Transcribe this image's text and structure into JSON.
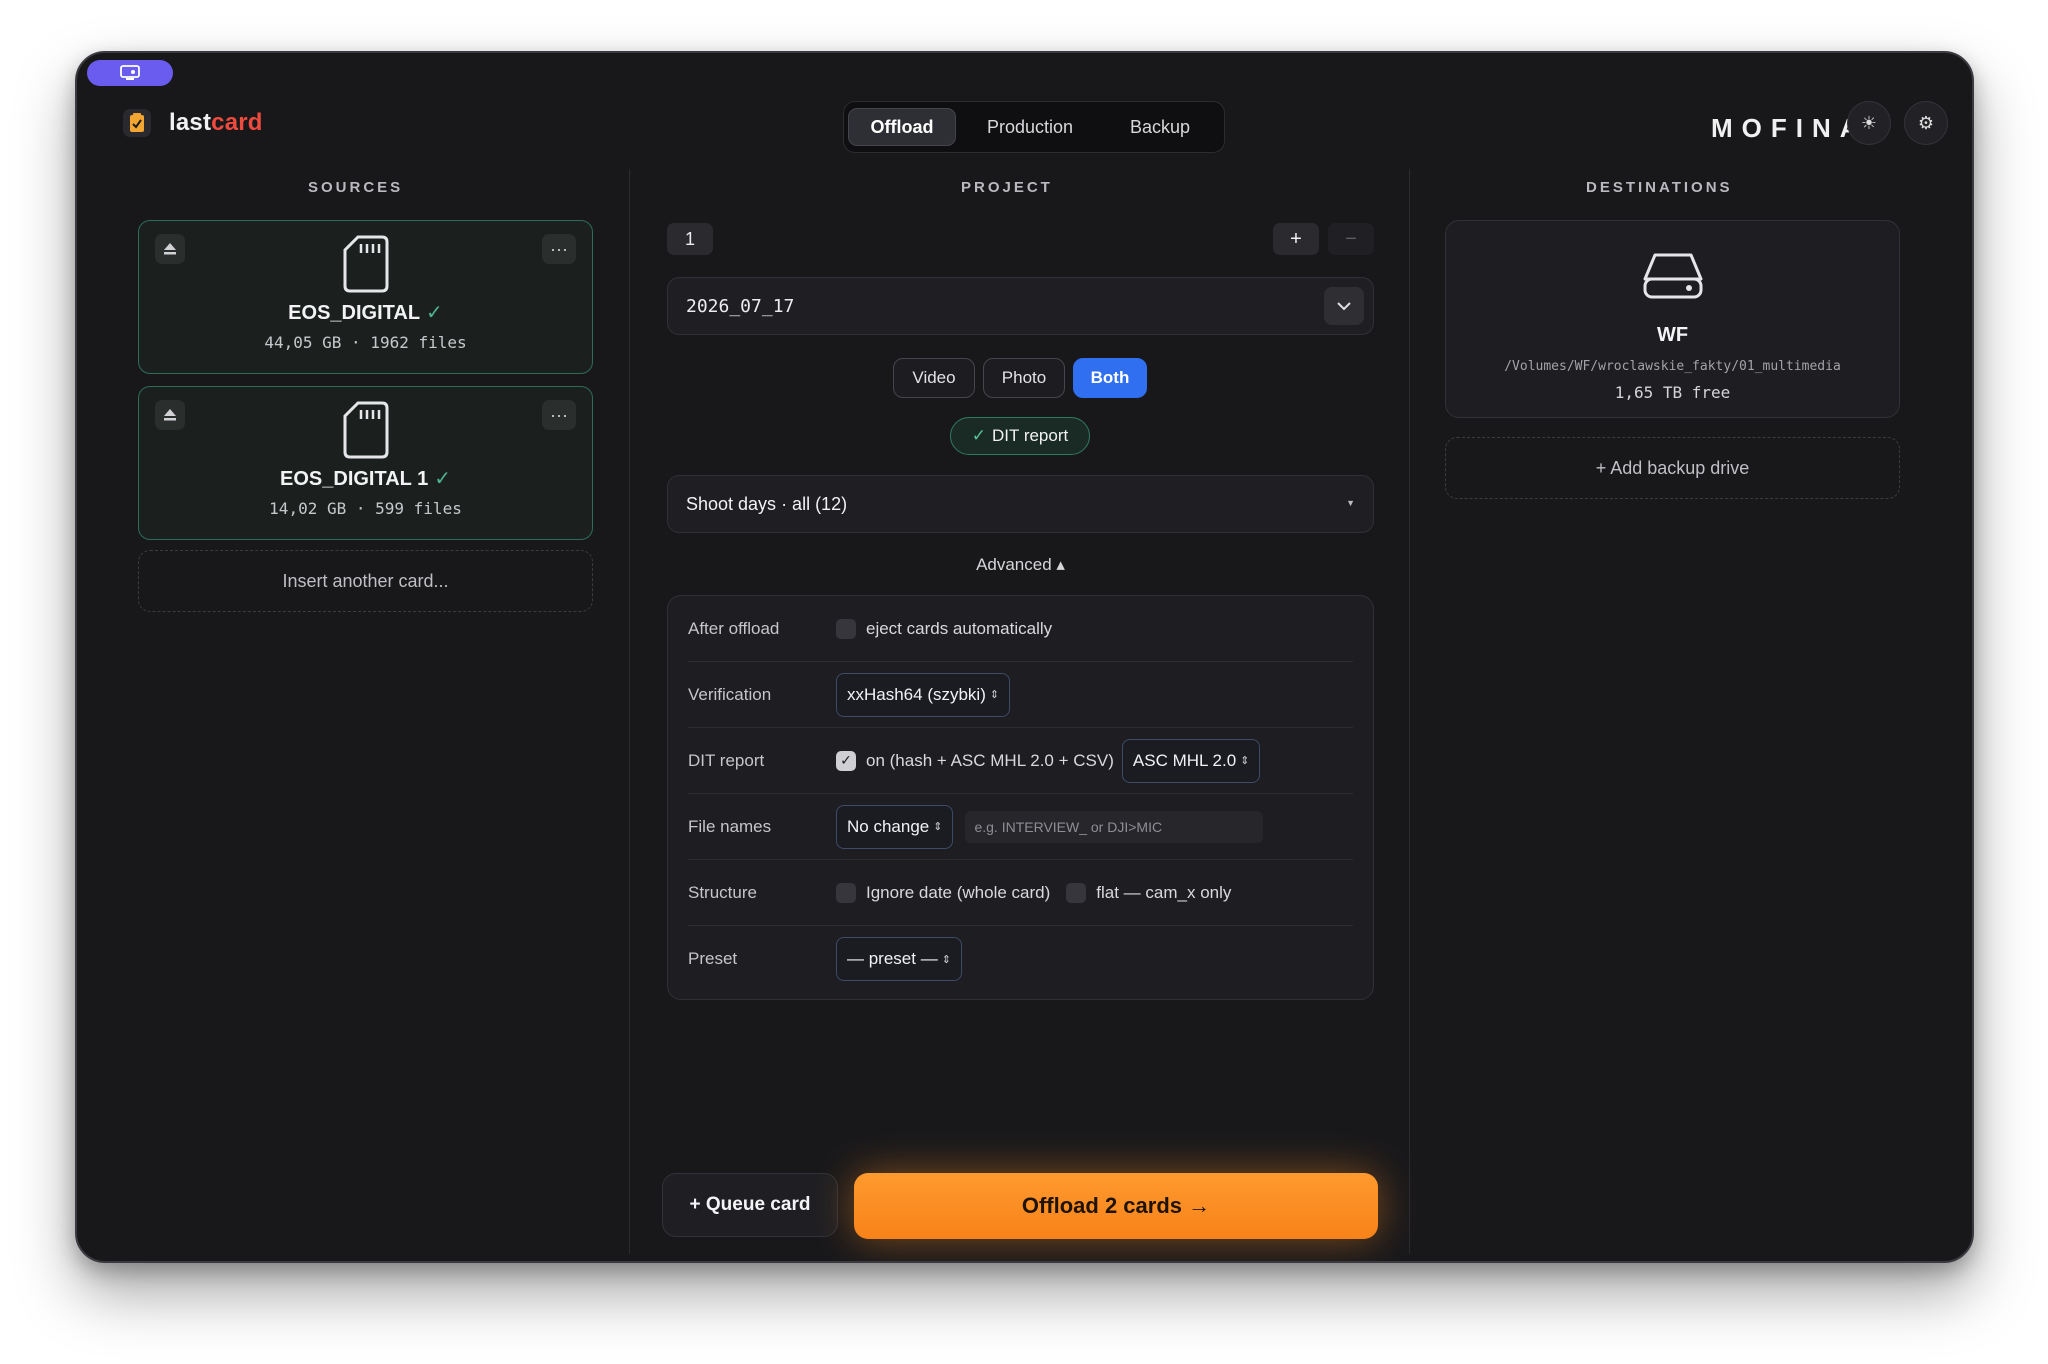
{
  "app": {
    "name_part1": "last",
    "name_part2": "card",
    "vendor": "MOFINA"
  },
  "modes": [
    {
      "label": "Offload",
      "active": true
    },
    {
      "label": "Production",
      "active": false
    },
    {
      "label": "Backup",
      "active": false
    }
  ],
  "sources": {
    "title": "SOURCES",
    "cards": [
      {
        "name": "EOS_DIGITAL",
        "meta": "44,05 GB · 1962 files"
      },
      {
        "name": "EOS_DIGITAL 1",
        "meta": "14,02 GB · 599 files"
      }
    ],
    "insert_label": "Insert another card..."
  },
  "project": {
    "title": "PROJECT",
    "number": "1",
    "add_label": "+",
    "remove_label": "−",
    "folder_name": "2026_07_17",
    "media_types": [
      "Video",
      "Photo",
      "Both"
    ],
    "selected_media": "Both",
    "dit_report_pill": "DIT report",
    "shoot_days": "Shoot days · all (12)",
    "advanced_label": "Advanced ▴"
  },
  "advanced": {
    "after_offload": {
      "label": "After offload",
      "option": "eject cards automatically",
      "checked": false
    },
    "verification": {
      "label": "Verification",
      "value": "xxHash64 (szybki)"
    },
    "dit_report": {
      "label": "DIT report",
      "option": "on (hash + ASC MHL 2.0 + CSV)",
      "checked": true,
      "format": "ASC MHL 2.0"
    },
    "file_names": {
      "label": "File names",
      "value": "No change",
      "placeholder": "e.g. INTERVIEW_  or  DJI>MIC"
    },
    "structure": {
      "label": "Structure",
      "option1": "Ignore date (whole card)",
      "option2": "flat — cam_x only"
    },
    "preset": {
      "label": "Preset",
      "value": "— preset —"
    }
  },
  "actions": {
    "queue": "+ Queue card",
    "offload": "Offload 2 cards →"
  },
  "destinations": {
    "title": "DESTINATIONS",
    "drive": {
      "name": "WF",
      "path": "/Volumes/WF/wroclawskie_fakty/01_multimedia",
      "free": "1,65 TB free"
    },
    "add_backup": "+ Add backup drive"
  },
  "colors": {
    "accent_orange": "#f7821a",
    "accent_blue": "#2f6ff0",
    "accent_green": "#4fb38d",
    "brand_red": "#ef4a3e"
  }
}
